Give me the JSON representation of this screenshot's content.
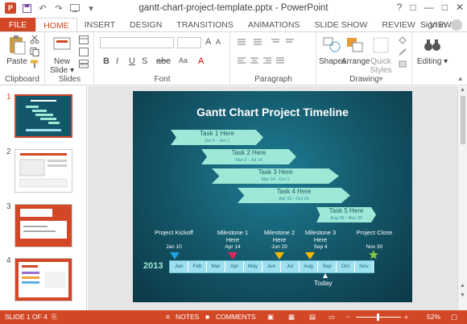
{
  "window": {
    "title": "gantt-chart-project-template.pptx - PowerPoint",
    "help": "?",
    "controls": [
      "□",
      "—",
      "□",
      "✕"
    ]
  },
  "tabs": [
    "FILE",
    "HOME",
    "INSERT",
    "DESIGN",
    "TRANSITIONS",
    "ANIMATIONS",
    "SLIDE SHOW",
    "REVIEW",
    "VIEW"
  ],
  "signin": "Sign in",
  "ribbon": {
    "clipboard": {
      "label": "Clipboard",
      "paste": "Paste"
    },
    "slides": {
      "label": "Slides",
      "new_slide": "New Slide ▾"
    },
    "font": {
      "label": "Font",
      "bold": "B",
      "italic": "I",
      "underline": "U",
      "strike": "S",
      "font_size_up": "A",
      "clear": "Aa"
    },
    "paragraph": {
      "label": "Paragraph"
    },
    "drawing": {
      "label": "Drawing",
      "shapes": "Shapes",
      "arrange": "Arrange",
      "quick_styles": "Quick Styles ▾"
    },
    "editing": {
      "label": "Editing ▾"
    }
  },
  "thumbnails": [
    {
      "num": "1",
      "active": true
    },
    {
      "num": "2",
      "active": false
    },
    {
      "num": "3",
      "active": false
    },
    {
      "num": "4",
      "active": false
    }
  ],
  "slide": {
    "title": "Gantt Chart Project Timeline",
    "tasks": [
      {
        "name": "Task 1 Here",
        "dates": "Jan 5 - Jan 1"
      },
      {
        "name": "Task 2 Here",
        "dates": "Mar 2 - Jul 14"
      },
      {
        "name": "Task 3 Here",
        "dates": "Mar 14 - Oct 2"
      },
      {
        "name": "Task 4 Here",
        "dates": "Apr 25 - Oct 26"
      },
      {
        "name": "Task 5 Here",
        "dates": "Aug 29 - Nov 30"
      }
    ],
    "milestones": [
      {
        "label": "Project Kickoff",
        "date": "Jan 10",
        "color": "#1aa0e0"
      },
      {
        "label": "Milestone 1 Here",
        "date": "Apr 14",
        "color": "#e0245e"
      },
      {
        "label": "Milestone 2 Here",
        "date": "Jun 29",
        "color": "#f5b800"
      },
      {
        "label": "Milestone 3 Here",
        "date": "Sep 4",
        "color": "#f5b800"
      },
      {
        "label": "Project Close",
        "date": "Nov 30",
        "color": "#8dc63f"
      }
    ],
    "year": "2013",
    "months": [
      "Jan",
      "Feb",
      "Mar",
      "Apr",
      "May",
      "Jun",
      "Jul",
      "Aug",
      "Sep",
      "Oct",
      "Nov"
    ],
    "today": "Today"
  },
  "status": {
    "slide_of": "SLIDE 1 OF 4",
    "notes": "NOTES",
    "comments": "COMMENTS",
    "zoom": "52%"
  },
  "colors": {
    "accent": "#d24726",
    "slide_bg": "#135466",
    "task_fill": "#9ee8d7"
  }
}
